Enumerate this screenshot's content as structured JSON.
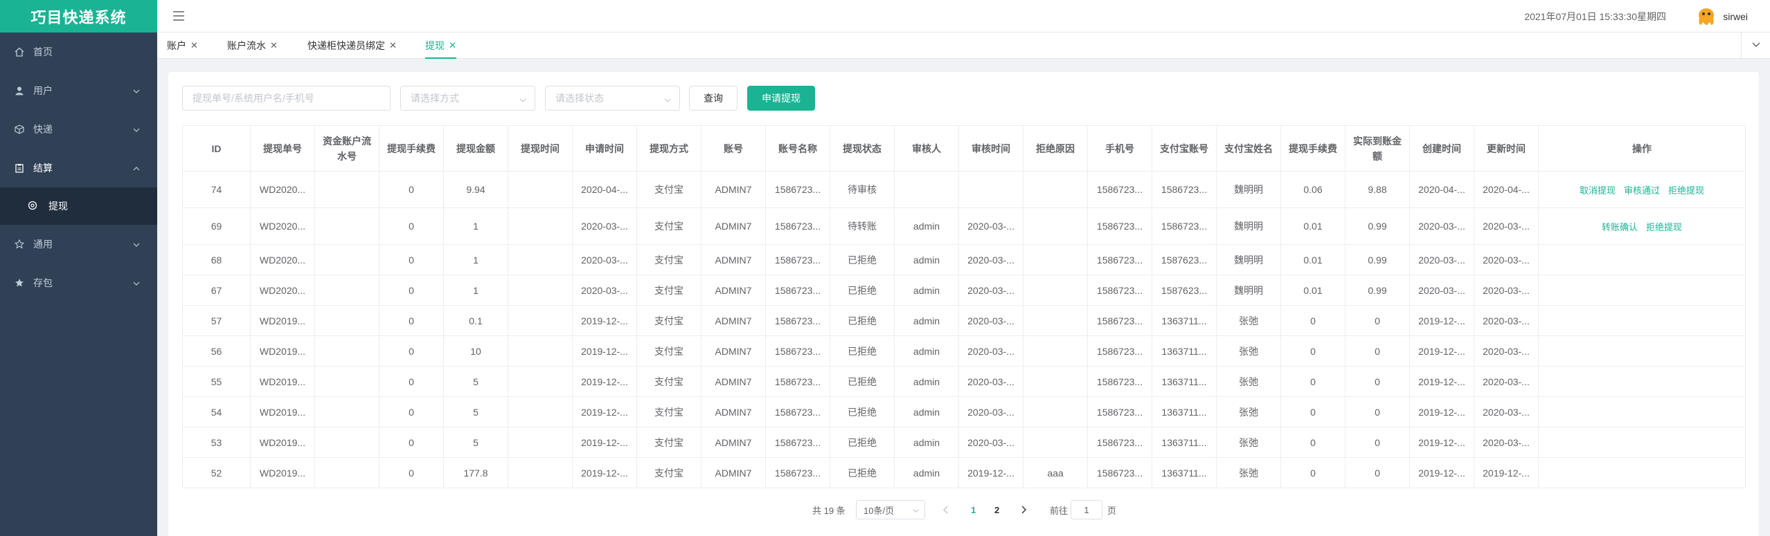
{
  "app": {
    "brand": "巧目快递系统",
    "datetime": "2021年07月01日 15:33:30星期四",
    "username": "sirwei"
  },
  "sidebar": {
    "items": [
      {
        "label": "首页",
        "icon": "home-icon"
      },
      {
        "label": "用户",
        "icon": "user-icon"
      },
      {
        "label": "快递",
        "icon": "package-icon"
      },
      {
        "label": "结算",
        "icon": "clipboard-icon"
      },
      {
        "label": "提现",
        "icon": "gear-icon"
      },
      {
        "label": "通用",
        "icon": "star-icon"
      },
      {
        "label": "存包",
        "icon": "star-filled-icon"
      }
    ]
  },
  "tabs": [
    {
      "label": "账户"
    },
    {
      "label": "账户流水"
    },
    {
      "label": "快递柜快递员绑定"
    },
    {
      "label": "提现"
    }
  ],
  "filters": {
    "search_placeholder": "提现单号/系统用户名/手机号",
    "method_placeholder": "请选择方式",
    "status_placeholder": "请选择状态",
    "query_label": "查询",
    "apply_label": "申请提现"
  },
  "table": {
    "headers": [
      "ID",
      "提现单号",
      "资金账户流水号",
      "提现手续费",
      "提现金额",
      "提现时间",
      "申请时间",
      "提现方式",
      "账号",
      "账号名称",
      "提现状态",
      "审核人",
      "审核时间",
      "拒绝原因",
      "手机号",
      "支付宝账号",
      "支付宝姓名",
      "提现手续费",
      "实际到账金额",
      "创建时间",
      "更新时间",
      "操作"
    ],
    "rows": [
      [
        "74",
        "WD2020...",
        "",
        "0",
        "9.94",
        "",
        "2020-04-...",
        "支付宝",
        "ADMIN7",
        "1586723...",
        "待审核",
        "",
        "",
        "",
        "1586723...",
        "1586723...",
        "魏明明",
        "0.06",
        "9.88",
        "2020-04-...",
        "2020-04-..."
      ],
      [
        "69",
        "WD2020...",
        "",
        "0",
        "1",
        "",
        "2020-03-...",
        "支付宝",
        "ADMIN7",
        "1586723...",
        "待转账",
        "admin",
        "2020-03-...",
        "",
        "1586723...",
        "1586723...",
        "魏明明",
        "0.01",
        "0.99",
        "2020-03-...",
        "2020-03-..."
      ],
      [
        "68",
        "WD2020...",
        "",
        "0",
        "1",
        "",
        "2020-03-...",
        "支付宝",
        "ADMIN7",
        "1586723...",
        "已拒绝",
        "admin",
        "2020-03-...",
        "",
        "1586723...",
        "1587623...",
        "魏明明",
        "0.01",
        "0.99",
        "2020-03-...",
        "2020-03-..."
      ],
      [
        "67",
        "WD2020...",
        "",
        "0",
        "1",
        "",
        "2020-03-...",
        "支付宝",
        "ADMIN7",
        "1586723...",
        "已拒绝",
        "admin",
        "2020-03-...",
        "",
        "1586723...",
        "1587623...",
        "魏明明",
        "0.01",
        "0.99",
        "2020-03-...",
        "2020-03-..."
      ],
      [
        "57",
        "WD2019...",
        "",
        "0",
        "0.1",
        "",
        "2019-12-...",
        "支付宝",
        "ADMIN7",
        "1586723...",
        "已拒绝",
        "admin",
        "2020-03-...",
        "",
        "1586723...",
        "1363711...",
        "张弛",
        "0",
        "0",
        "2019-12-...",
        "2020-03-..."
      ],
      [
        "56",
        "WD2019...",
        "",
        "0",
        "10",
        "",
        "2019-12-...",
        "支付宝",
        "ADMIN7",
        "1586723...",
        "已拒绝",
        "admin",
        "2020-03-...",
        "",
        "1586723...",
        "1363711...",
        "张弛",
        "0",
        "0",
        "2019-12-...",
        "2020-03-..."
      ],
      [
        "55",
        "WD2019...",
        "",
        "0",
        "5",
        "",
        "2019-12-...",
        "支付宝",
        "ADMIN7",
        "1586723...",
        "已拒绝",
        "admin",
        "2020-03-...",
        "",
        "1586723...",
        "1363711...",
        "张弛",
        "0",
        "0",
        "2019-12-...",
        "2020-03-..."
      ],
      [
        "54",
        "WD2019...",
        "",
        "0",
        "5",
        "",
        "2019-12-...",
        "支付宝",
        "ADMIN7",
        "1586723...",
        "已拒绝",
        "admin",
        "2020-03-...",
        "",
        "1586723...",
        "1363711...",
        "张弛",
        "0",
        "0",
        "2019-12-...",
        "2020-03-..."
      ],
      [
        "53",
        "WD2019...",
        "",
        "0",
        "5",
        "",
        "2019-12-...",
        "支付宝",
        "ADMIN7",
        "1586723...",
        "已拒绝",
        "admin",
        "2020-03-...",
        "",
        "1586723...",
        "1363711...",
        "张弛",
        "0",
        "0",
        "2019-12-...",
        "2020-03-..."
      ],
      [
        "52",
        "WD2019...",
        "",
        "0",
        "177.8",
        "",
        "2019-12-...",
        "支付宝",
        "ADMIN7",
        "1586723...",
        "已拒绝",
        "admin",
        "2019-12-...",
        "aaa",
        "1586723...",
        "1363711...",
        "张弛",
        "0",
        "0",
        "2019-12-...",
        "2019-12-..."
      ]
    ],
    "actions": [
      [
        "取消提现",
        "审核通过",
        "拒绝提现"
      ],
      [
        "转账确认",
        "拒绝提现"
      ],
      [],
      [],
      [],
      [],
      [],
      [],
      [],
      []
    ]
  },
  "pagination": {
    "total": "共 19 条",
    "page_size": "10条/页",
    "pages": [
      "1",
      "2"
    ],
    "current_page": "1",
    "goto_label": "前往",
    "goto_value": "1",
    "page_suffix": "页"
  },
  "colors": {
    "brand": "#1ab394",
    "sidebar": "#304156",
    "submenu": "#1f2d3d"
  }
}
